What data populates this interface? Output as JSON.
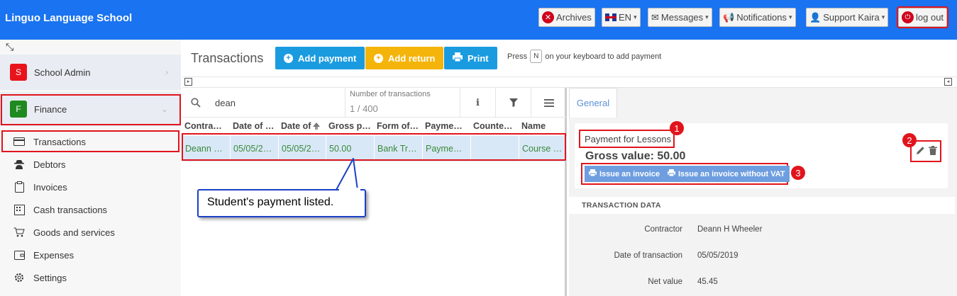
{
  "app": {
    "brand": "Linguo Language School"
  },
  "topbar": {
    "archives": "Archives",
    "language": "EN",
    "messages": "Messages",
    "notifications": "Notifications",
    "user": "Support Kaira",
    "logout": "log out"
  },
  "sidebar": {
    "sections": [
      {
        "badge": "S",
        "label": "School Admin",
        "color": "#e8141c"
      },
      {
        "badge": "F",
        "label": "Finance",
        "color": "#1f8a1f"
      }
    ],
    "items": [
      {
        "label": "Transactions",
        "icon": "card-icon"
      },
      {
        "label": "Debtors",
        "icon": "spy-icon"
      },
      {
        "label": "Invoices",
        "icon": "clipboard-icon"
      },
      {
        "label": "Cash transactions",
        "icon": "register-icon"
      },
      {
        "label": "Goods and services",
        "icon": "cart-icon"
      },
      {
        "label": "Expenses",
        "icon": "wallet-icon"
      },
      {
        "label": "Settings",
        "icon": "gear-icon"
      }
    ]
  },
  "header": {
    "title": "Transactions",
    "add_payment": "Add payment",
    "add_return": "Add return",
    "print": "Print",
    "hint_before": "Press",
    "hint_key": "N",
    "hint_after": "on your keyboard to add payment"
  },
  "table": {
    "search_value": "dean",
    "count_label": "Number of transactions",
    "count_value": "1 / 400",
    "columns": [
      "Contra…",
      "Date of …",
      "Date of",
      "Gross p…",
      "Form of…",
      "Payme…",
      "Counte…",
      "Name"
    ],
    "row": [
      "Deann …",
      "05/05/2…",
      "05/05/2…",
      "50.00",
      "Bank Tr…",
      "Payme…",
      "",
      "Course …"
    ]
  },
  "callout": {
    "text": "Student's payment listed."
  },
  "detail": {
    "tab": "General",
    "payment_title": "Payment for Lessons",
    "gross_value": "Gross value: 50.00",
    "issue_invoice": "Issue an invoice",
    "issue_invoice_no_vat": "Issue an invoice without VAT",
    "markers": [
      "1",
      "2",
      "3"
    ],
    "section_title": "TRANSACTION DATA",
    "fields": [
      {
        "label": "Contractor",
        "value": "Deann H Wheeler"
      },
      {
        "label": "Date of transaction",
        "value": "05/05/2019"
      },
      {
        "label": "Net value",
        "value": "45.45"
      }
    ]
  },
  "colors": {
    "topbar": "#1a73f0",
    "primary_btn": "#1a9be0",
    "warning_btn": "#f5b40a",
    "highlight": "#e1141c"
  }
}
